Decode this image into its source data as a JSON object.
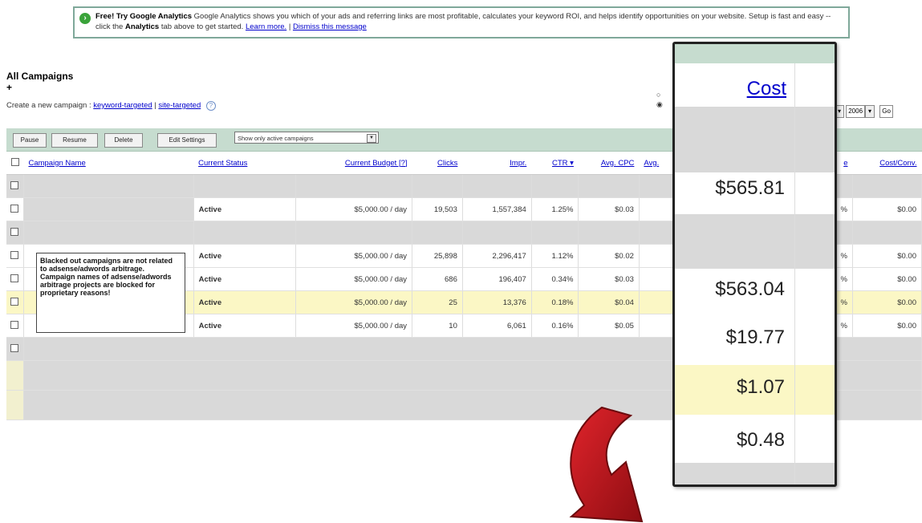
{
  "banner": {
    "lead": "Free! Try Google Analytics",
    "text": "Google Analytics shows you which of your ads and referring links are most profitable, calculates your keyword ROI, and helps identify opportunities on your website. Setup is fast and easy -- click the",
    "analytics_word": "Analytics",
    "text_tail": "tab above to get started.",
    "learn_more": "Learn more.",
    "dismiss": "Dismiss this message"
  },
  "page": {
    "title": "All Campaigns",
    "plus": "+",
    "create_label": "Create a new campaign :",
    "keyword_link": "keyword-targeted",
    "site_link": "site-targeted",
    "help": "?"
  },
  "date": {
    "year": "2006",
    "go": "Go"
  },
  "toolbar": {
    "pause": "Pause",
    "resume": "Resume",
    "delete": "Delete",
    "edit": "Edit Settings",
    "filter": "Show only active campaigns"
  },
  "columns": {
    "name": "Campaign Name",
    "status": "Current Status",
    "budget": "Current Budget [?]",
    "clicks": "Clicks",
    "impr": "Impr.",
    "ctr": "CTR ▾",
    "cpc": "Avg. CPC",
    "avg": "Avg.",
    "rate": "e",
    "costconv": "Cost/Conv."
  },
  "rows": [
    {
      "status": "",
      "budget": "",
      "clicks": "",
      "impr": "",
      "ctr": "",
      "cpc": "",
      "rate": "",
      "costconv": ""
    },
    {
      "status": "Active",
      "budget": "$5,000.00 / day",
      "clicks": "19,503",
      "impr": "1,557,384",
      "ctr": "1.25%",
      "cpc": "$0.03",
      "rate": "%",
      "costconv": "$0.00"
    },
    {
      "status": "",
      "budget": "",
      "clicks": "",
      "impr": "",
      "ctr": "",
      "cpc": "",
      "rate": "",
      "costconv": ""
    },
    {
      "status": "Active",
      "budget": "$5,000.00 / day",
      "clicks": "25,898",
      "impr": "2,296,417",
      "ctr": "1.12%",
      "cpc": "$0.02",
      "rate": "%",
      "costconv": "$0.00"
    },
    {
      "status": "Active",
      "budget": "$5,000.00 / day",
      "clicks": "686",
      "impr": "196,407",
      "ctr": "0.34%",
      "cpc": "$0.03",
      "rate": "%",
      "costconv": "$0.00"
    },
    {
      "status": "Active",
      "budget": "$5,000.00 / day",
      "clicks": "25",
      "impr": "13,376",
      "ctr": "0.18%",
      "cpc": "$0.04",
      "rate": "%",
      "costconv": "$0.00"
    },
    {
      "status": "Active",
      "budget": "$5,000.00 / day",
      "clicks": "10",
      "impr": "6,061",
      "ctr": "0.16%",
      "cpc": "$0.05",
      "rate": "%",
      "costconv": "$0.00"
    }
  ],
  "note": "Blacked out campaigns are not related to adsense/adwords arbitrage. Campaign names of adsense/adwords arbitrage projects are blocked for proprietary reasons!",
  "zoom": {
    "header": "Cost",
    "values": [
      "$565.81",
      "$563.04",
      "$19.77",
      "$1.07",
      "$0.48"
    ]
  },
  "colors": {
    "toolbar": "#c6dccf",
    "active": "#2e8b2e",
    "highlight": "#fbf7c5",
    "arrow": "#c0141b"
  }
}
